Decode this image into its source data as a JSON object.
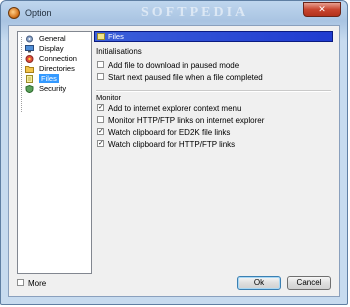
{
  "window": {
    "title": "Option",
    "watermark": "SOFTPEDIA",
    "close_glyph": "✕"
  },
  "tree": {
    "items": [
      {
        "label": "General",
        "icon": "gear-icon"
      },
      {
        "label": "Display",
        "icon": "monitor-icon"
      },
      {
        "label": "Connection",
        "icon": "network-icon"
      },
      {
        "label": "Directories",
        "icon": "folder-icon"
      },
      {
        "label": "Files",
        "icon": "files-icon",
        "selected": true
      },
      {
        "label": "Security",
        "icon": "shield-icon"
      }
    ]
  },
  "panel": {
    "header": "Files",
    "initialisations": {
      "title": "Initialisations",
      "options": [
        {
          "label": "Add file to download in paused mode",
          "checked": false
        },
        {
          "label": "Start next paused file when a file completed",
          "checked": false
        }
      ]
    },
    "monitor": {
      "title": "Monitor",
      "options": [
        {
          "label": "Add to internet explorer context menu",
          "checked": true
        },
        {
          "label": "Monitor HTTP/FTP links on internet explorer",
          "checked": false
        },
        {
          "label": "Watch clipboard for ED2K file links",
          "checked": true
        },
        {
          "label": "Watch clipboard for HTTP/FTP links",
          "checked": true
        }
      ]
    }
  },
  "footer": {
    "more_label": "More",
    "more_checked": false,
    "ok_label": "Ok",
    "cancel_label": "Cancel"
  },
  "colors": {
    "header_bar": "#1f3bd0",
    "selection": "#3399ff"
  }
}
